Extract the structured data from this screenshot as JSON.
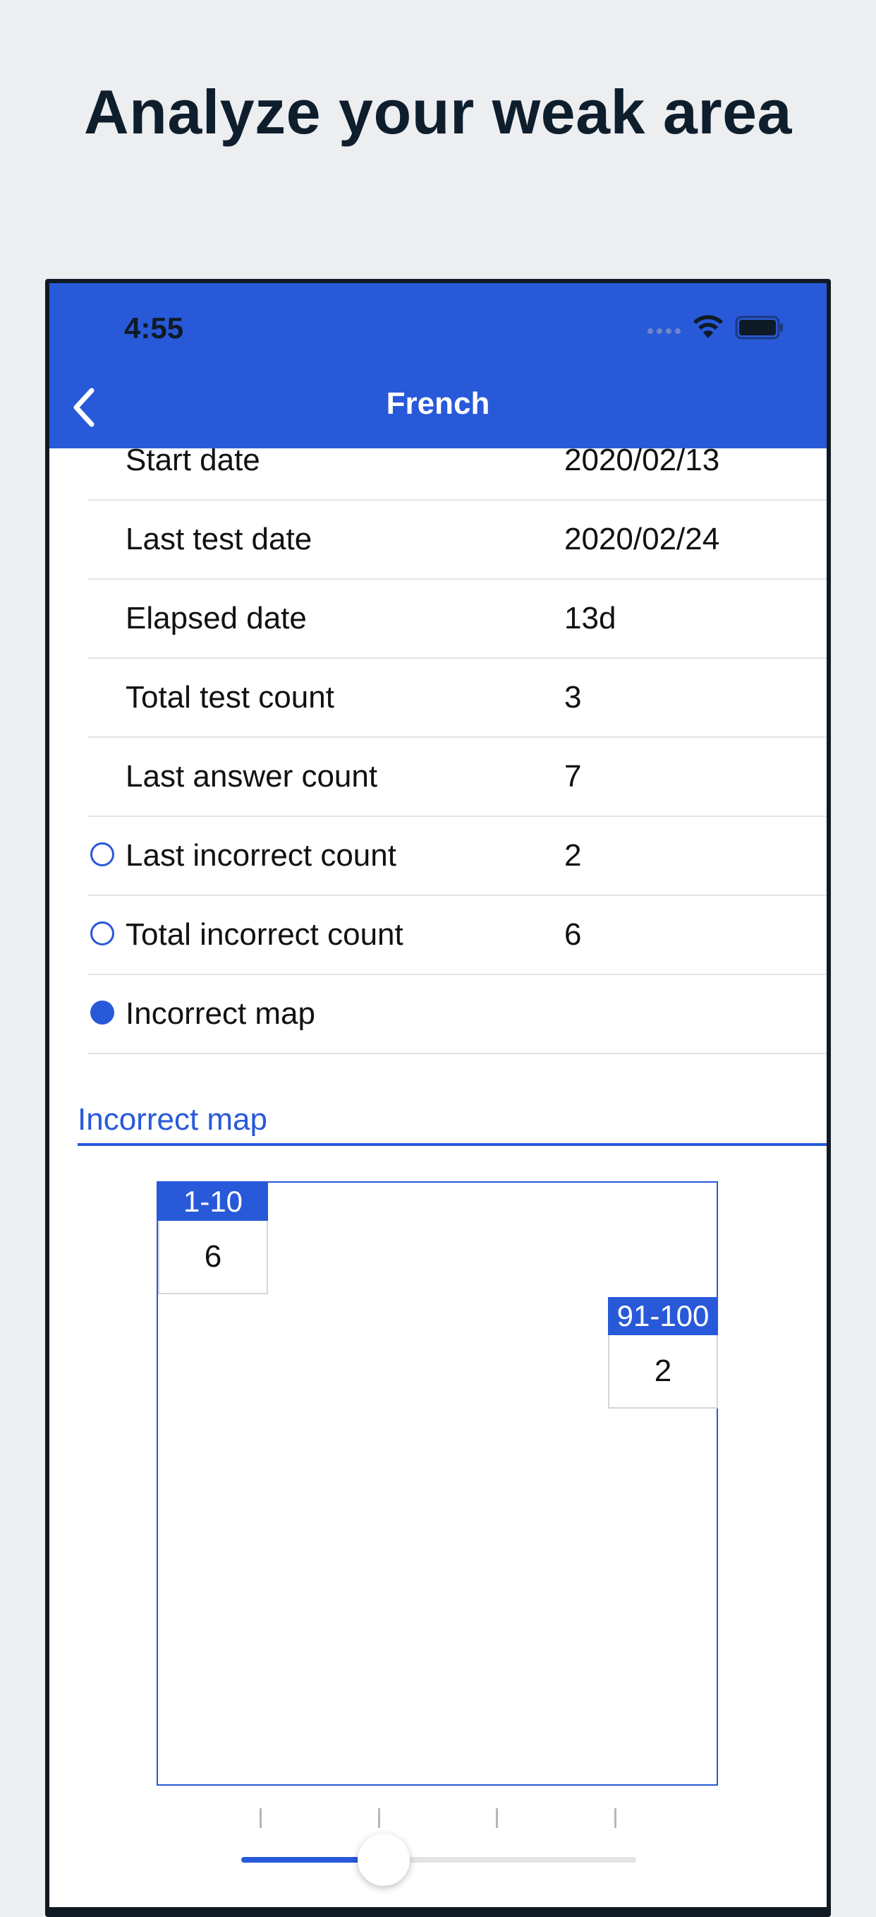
{
  "headline": "Analyze your weak area",
  "status_bar": {
    "time": "4:55"
  },
  "nav": {
    "title": "French"
  },
  "stats": [
    {
      "label": "Start date",
      "value": "2020/02/13",
      "marker": "none"
    },
    {
      "label": "Last test date",
      "value": "2020/02/24",
      "marker": "none"
    },
    {
      "label": "Elapsed date",
      "value": "13d",
      "marker": "none"
    },
    {
      "label": "Total test count",
      "value": "3",
      "marker": "none"
    },
    {
      "label": "Last answer count",
      "value": "7",
      "marker": "none"
    },
    {
      "label": "Last incorrect count",
      "value": "2",
      "marker": "open"
    },
    {
      "label": "Total incorrect count",
      "value": "6",
      "marker": "open"
    },
    {
      "label": "Incorrect map",
      "value": "",
      "marker": "filled"
    }
  ],
  "incorrect_map": {
    "section_title": "Incorrect map",
    "cells": [
      {
        "range": "1-10",
        "count": "6"
      },
      {
        "range": "91-100",
        "count": "2"
      }
    ]
  },
  "slider": {
    "value": 0.36
  },
  "colors": {
    "accent": "#2859D8",
    "background": "#ECEEF0",
    "headline": "#0F1E2D"
  }
}
